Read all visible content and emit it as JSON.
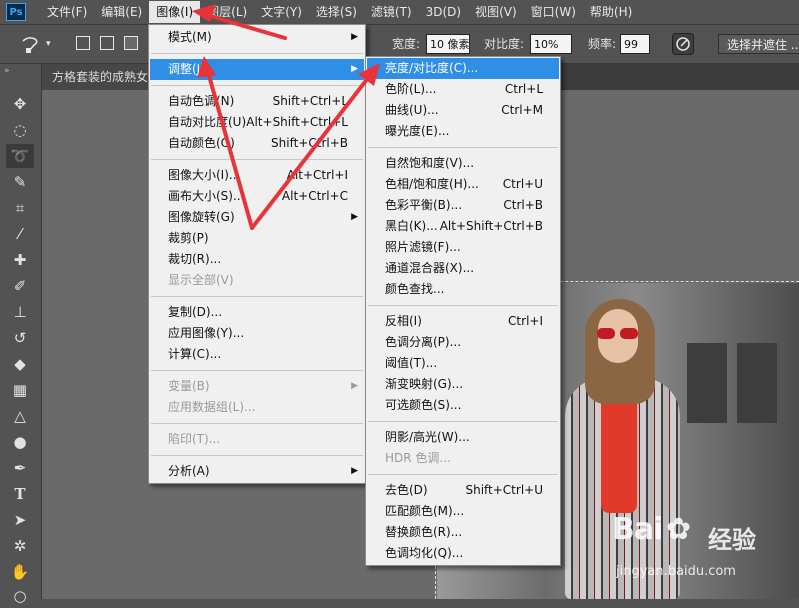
{
  "menubar": {
    "logo": "Ps",
    "items": [
      "文件(F)",
      "编辑(E)",
      "图像(I)",
      "图层(L)",
      "文字(Y)",
      "选择(S)",
      "滤镜(T)",
      "3D(D)",
      "视图(V)",
      "窗口(W)",
      "帮助(H)"
    ],
    "active_index": 2
  },
  "options": {
    "width_label": "宽度:",
    "width_value": "10 像素",
    "contrast_label": "对比度:",
    "contrast_value": "10%",
    "freq_label": "频率:",
    "freq_value": "99",
    "mask_button": "选择并遮住 ..."
  },
  "document": {
    "tab_title": "方格套装的成熟女"
  },
  "image_menu": {
    "items": [
      {
        "label": "模式(M)",
        "shortcut": "",
        "submenu": true,
        "disabled": false
      },
      {
        "label": "调整(J)",
        "shortcut": "",
        "submenu": true,
        "disabled": false,
        "highlighted": true
      },
      {
        "label": "自动色调(N)",
        "shortcut": "Shift+Ctrl+L",
        "submenu": false,
        "disabled": false
      },
      {
        "label": "自动对比度(U)",
        "shortcut": "Alt+Shift+Ctrl+L",
        "submenu": false,
        "disabled": false
      },
      {
        "label": "自动颜色(O)",
        "shortcut": "Shift+Ctrl+B",
        "submenu": false,
        "disabled": false
      },
      {
        "label": "图像大小(I)...",
        "shortcut": "Alt+Ctrl+I",
        "submenu": false,
        "disabled": false
      },
      {
        "label": "画布大小(S)...",
        "shortcut": "Alt+Ctrl+C",
        "submenu": false,
        "disabled": false
      },
      {
        "label": "图像旋转(G)",
        "shortcut": "",
        "submenu": true,
        "disabled": false
      },
      {
        "label": "裁剪(P)",
        "shortcut": "",
        "submenu": false,
        "disabled": false
      },
      {
        "label": "裁切(R)...",
        "shortcut": "",
        "submenu": false,
        "disabled": false
      },
      {
        "label": "显示全部(V)",
        "shortcut": "",
        "submenu": false,
        "disabled": true
      },
      {
        "label": "复制(D)...",
        "shortcut": "",
        "submenu": false,
        "disabled": false
      },
      {
        "label": "应用图像(Y)...",
        "shortcut": "",
        "submenu": false,
        "disabled": false
      },
      {
        "label": "计算(C)...",
        "shortcut": "",
        "submenu": false,
        "disabled": false
      },
      {
        "label": "变量(B)",
        "shortcut": "",
        "submenu": true,
        "disabled": true
      },
      {
        "label": "应用数据组(L)...",
        "shortcut": "",
        "submenu": false,
        "disabled": true
      },
      {
        "label": "陷印(T)...",
        "shortcut": "",
        "submenu": false,
        "disabled": true
      },
      {
        "label": "分析(A)",
        "shortcut": "",
        "submenu": true,
        "disabled": false
      }
    ]
  },
  "adjust_menu": {
    "items": [
      {
        "label": "亮度/对比度(C)...",
        "shortcut": "",
        "disabled": false,
        "highlighted": true
      },
      {
        "label": "色阶(L)...",
        "shortcut": "Ctrl+L",
        "disabled": false
      },
      {
        "label": "曲线(U)...",
        "shortcut": "Ctrl+M",
        "disabled": false
      },
      {
        "label": "曝光度(E)...",
        "shortcut": "",
        "disabled": false
      },
      {
        "label": "自然饱和度(V)...",
        "shortcut": "",
        "disabled": false
      },
      {
        "label": "色相/饱和度(H)...",
        "shortcut": "Ctrl+U",
        "disabled": false
      },
      {
        "label": "色彩平衡(B)...",
        "shortcut": "Ctrl+B",
        "disabled": false
      },
      {
        "label": "黑白(K)...",
        "shortcut": "Alt+Shift+Ctrl+B",
        "disabled": false
      },
      {
        "label": "照片滤镜(F)...",
        "shortcut": "",
        "disabled": false
      },
      {
        "label": "通道混合器(X)...",
        "shortcut": "",
        "disabled": false
      },
      {
        "label": "颜色查找...",
        "shortcut": "",
        "disabled": false
      },
      {
        "label": "反相(I)",
        "shortcut": "Ctrl+I",
        "disabled": false
      },
      {
        "label": "色调分离(P)...",
        "shortcut": "",
        "disabled": false
      },
      {
        "label": "阈值(T)...",
        "shortcut": "",
        "disabled": false
      },
      {
        "label": "渐变映射(G)...",
        "shortcut": "",
        "disabled": false
      },
      {
        "label": "可选颜色(S)...",
        "shortcut": "",
        "disabled": false
      },
      {
        "label": "阴影/高光(W)...",
        "shortcut": "",
        "disabled": false
      },
      {
        "label": "HDR 色调...",
        "shortcut": "",
        "disabled": true
      },
      {
        "label": "去色(D)",
        "shortcut": "Shift+Ctrl+U",
        "disabled": false
      },
      {
        "label": "匹配颜色(M)...",
        "shortcut": "",
        "disabled": false
      },
      {
        "label": "替换颜色(R)...",
        "shortcut": "",
        "disabled": false
      },
      {
        "label": "色调均化(Q)...",
        "shortcut": "",
        "disabled": false
      }
    ]
  },
  "watermark": {
    "logo_left": "Bai",
    "logo_right": "经验",
    "url": "jingyan.baidu.com"
  },
  "colors": {
    "highlight": "#2f8fe6",
    "annotation_arrow": "#e8333b",
    "menu_bg": "#f0f0f0",
    "app_bg": "#535353"
  }
}
